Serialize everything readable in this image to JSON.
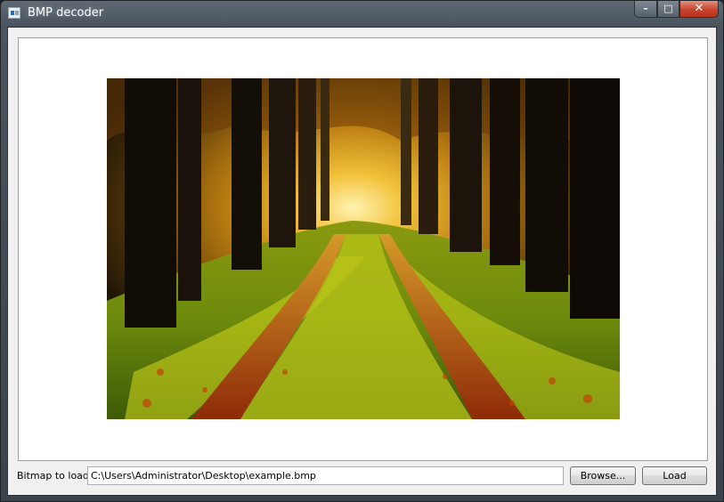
{
  "window": {
    "title": "BMP decoder"
  },
  "caption_buttons": {
    "minimize": "–",
    "maximize": "□",
    "close": "✕"
  },
  "icons": {
    "app": "app-window-icon",
    "minimize": "minimize-icon",
    "maximize": "maximize-icon",
    "close": "close-icon"
  },
  "loader": {
    "label": "Bitmap to load:",
    "path_value": "C:\\Users\\Administrator\\Desktop\\example.bmp",
    "browse_label": "Browse...",
    "load_label": "Load"
  },
  "colors": {
    "close_button": "#c6432c",
    "client_background": "#f0f0f0",
    "image_frame_background": "#ffffff"
  }
}
